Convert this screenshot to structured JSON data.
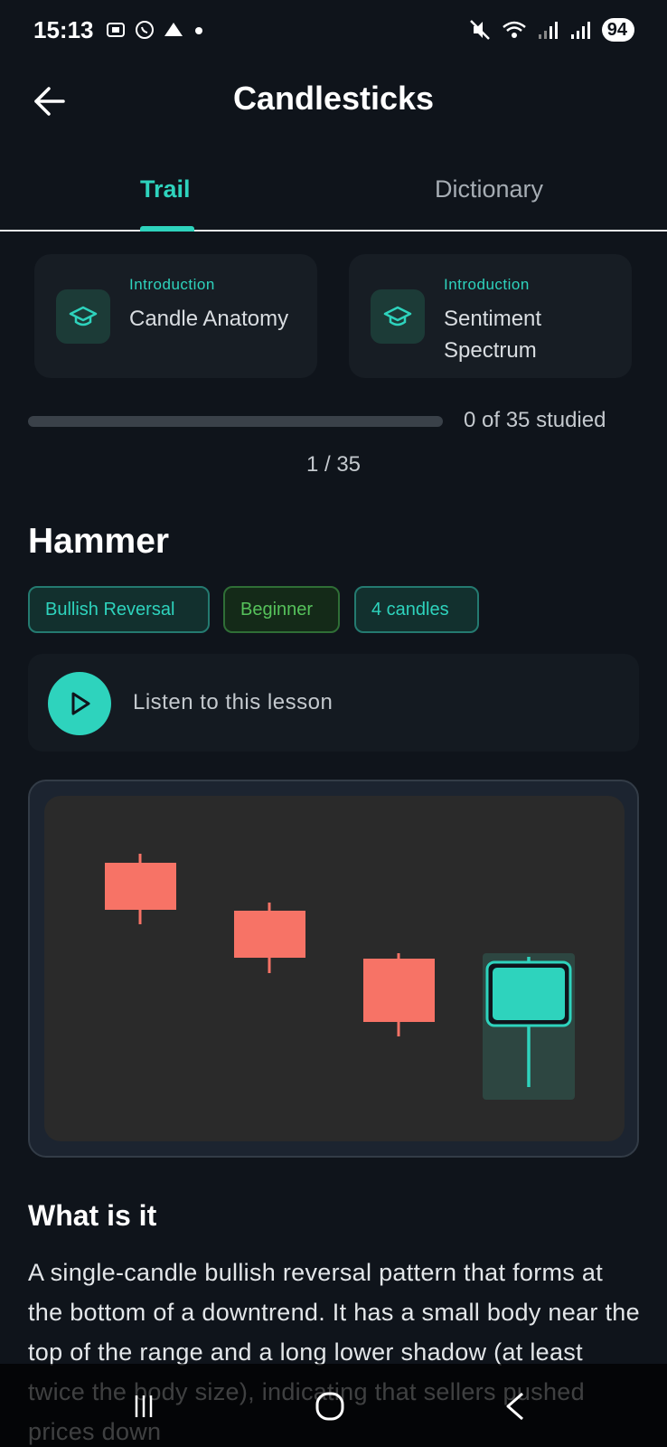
{
  "status_bar": {
    "time": "15:13",
    "battery": "94",
    "icons_left": [
      "screenshot-icon",
      "whatsapp-icon",
      "drive-icon",
      "dot-icon"
    ],
    "icons_right": [
      "mute-icon",
      "wifi-icon",
      "signal-icon",
      "signal-icon",
      "battery-icon"
    ]
  },
  "header": {
    "title": "Candlesticks"
  },
  "tabs": [
    {
      "label": "Trail",
      "active": true
    },
    {
      "label": "Dictionary",
      "active": false
    }
  ],
  "cards": [
    {
      "kicker": "Introduction",
      "title": "Candle Anatomy",
      "icon": "graduation-cap-icon"
    },
    {
      "kicker": "Introduction",
      "title": "Sentiment Spectrum",
      "icon": "graduation-cap-icon"
    }
  ],
  "progress": {
    "label": "0 of 35 studied",
    "fraction": 0
  },
  "counter": "1 / 35",
  "pattern": {
    "title": "Hammer",
    "tags": [
      "Bullish Reversal",
      "Beginner",
      "4 candles"
    ]
  },
  "listen": {
    "label": "Listen to this lesson"
  },
  "illustration": {
    "candles": [
      {
        "type": "bearish",
        "color": "#f77366"
      },
      {
        "type": "bearish",
        "color": "#f77366"
      },
      {
        "type": "bearish",
        "color": "#f77366"
      },
      {
        "type": "hammer-highlighted",
        "color": "#2ed3bd"
      }
    ]
  },
  "section": {
    "title": "What is it",
    "body": "A single-candle bullish reversal pattern that forms at the bottom of a downtrend. It has a small body near the top of the range and a long lower shadow (at least twice the body size), indicating that sellers pushed prices down"
  },
  "colors": {
    "accent": "#2ed3bd",
    "bearish": "#f77366",
    "background": "#0f141b"
  }
}
